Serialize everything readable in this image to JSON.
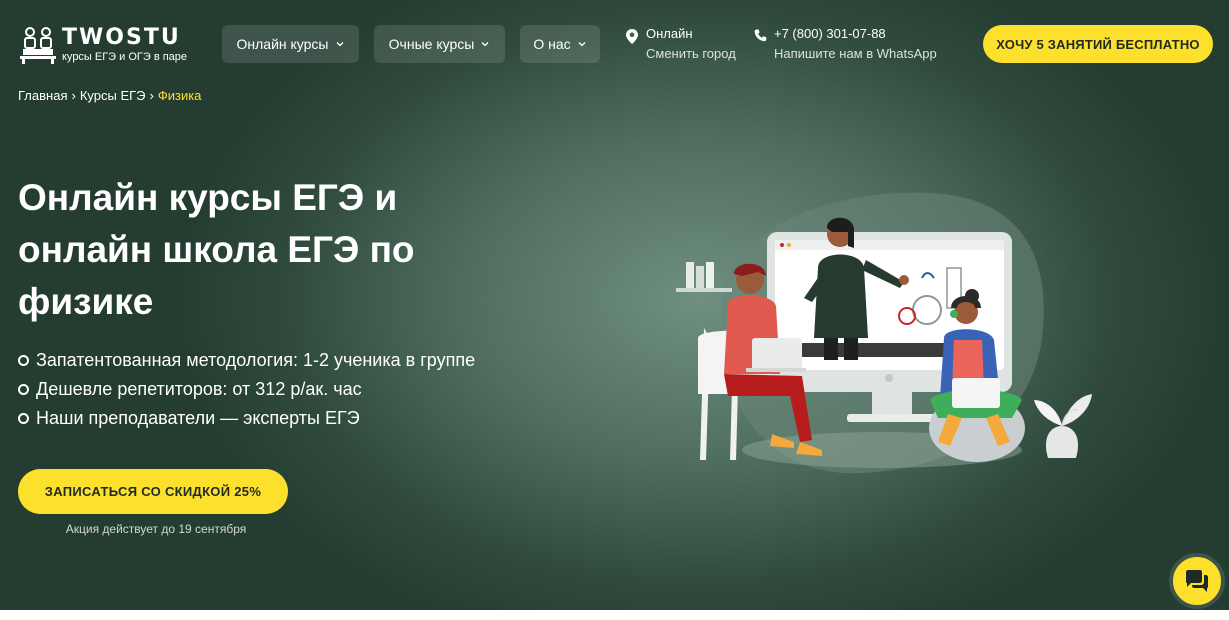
{
  "header": {
    "logo": {
      "name": "TWOSTU",
      "tagline": "курсы ЕГЭ и ОГЭ в паре"
    },
    "nav": [
      {
        "label": "Онлайн курсы"
      },
      {
        "label": "Очные курсы"
      },
      {
        "label": "О нас"
      }
    ],
    "location": {
      "city": "Онлайн",
      "change": "Сменить город"
    },
    "contact": {
      "phone": "+7 (800) 301-07-88",
      "whatsapp": "Напишите нам в WhatsApp"
    },
    "cta": "ХОЧУ 5 ЗАНЯТИЙ БЕСПЛАТНО"
  },
  "breadcrumbs": [
    {
      "label": "Главная"
    },
    {
      "label": "Курсы ЕГЭ"
    },
    {
      "label": "Физика"
    }
  ],
  "breadcrumb_separator": "›",
  "hero": {
    "title": "Онлайн курсы ЕГЭ и онлайн школа ЕГЭ по физике",
    "features": [
      "Запатентованная методология: 1-2 ученика в группе",
      "Дешевле репетиторов: от 312 р/ак. час",
      "Наши преподаватели — эксперты ЕГЭ"
    ],
    "cta": "ЗАПИСАТЬСЯ СО СКИДКОЙ 25%",
    "promo_note": "Акция действует до 19 сентября"
  },
  "colors": {
    "accent": "#fde02b",
    "background_dark": "#2f4a3d",
    "background_light": "#6f8f81"
  },
  "icons": {
    "location": "map-pin-icon",
    "phone": "phone-icon",
    "chevron": "chevron-down-icon",
    "chat": "chat-bubbles-icon"
  }
}
